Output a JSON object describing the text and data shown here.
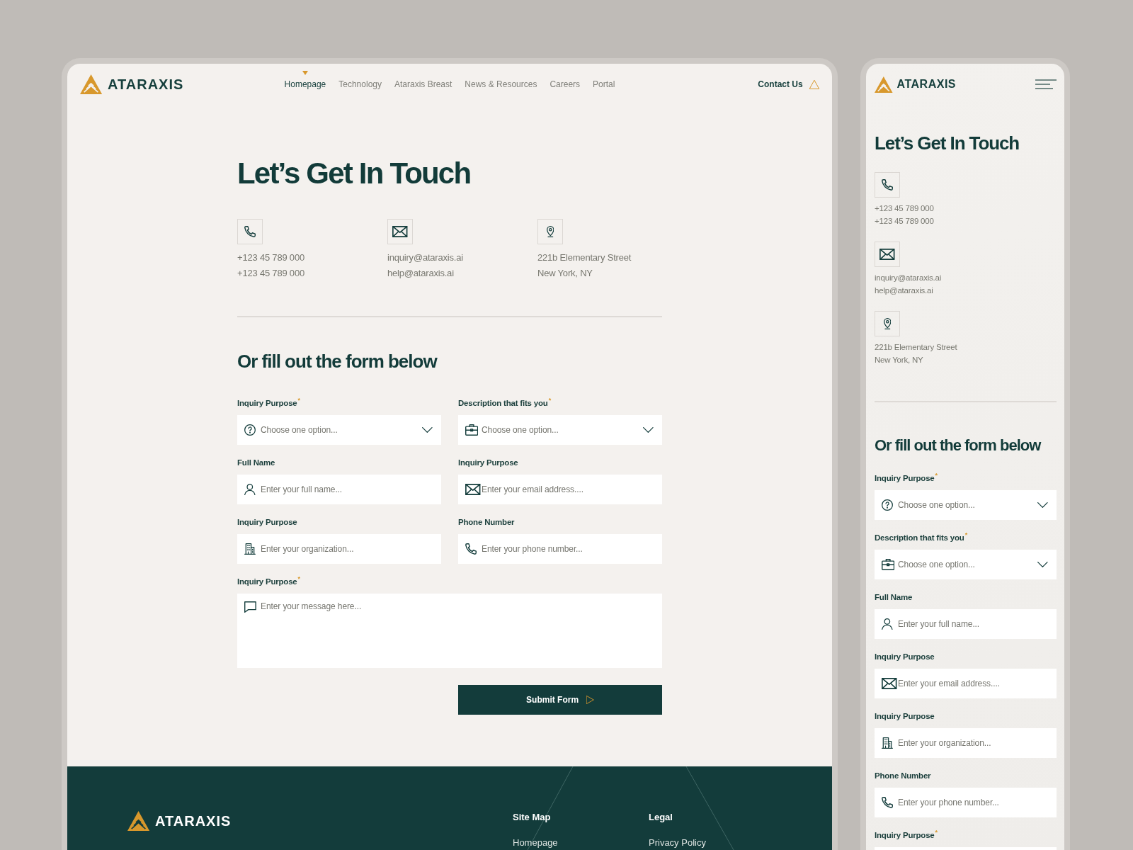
{
  "desktop": {
    "header": {
      "logo": "ATARAXIS",
      "nav": [
        {
          "label": "Homepage",
          "selected": true
        },
        {
          "label": "Technology",
          "selected": false
        },
        {
          "label": "Ataraxis Breast",
          "selected": false
        },
        {
          "label": "News & Resources",
          "selected": false
        },
        {
          "label": "Careers",
          "selected": false
        },
        {
          "label": "Portal",
          "selected": false
        }
      ],
      "contact_link": "Contact Us"
    },
    "contact": {
      "title": "Let’s Get In Touch",
      "items": [
        {
          "kind": "phone",
          "lines": [
            "+123 45 789 000",
            "+123 45 789 000"
          ]
        },
        {
          "kind": "email",
          "lines": [
            "inquiry@ataraxis.ai",
            "help@ataraxis.ai"
          ]
        },
        {
          "kind": "address",
          "lines": [
            "221b Elementary Street",
            "New York, NY"
          ]
        }
      ]
    },
    "form": {
      "title": "Or fill out the form below",
      "fields": [
        {
          "kind": "purpose",
          "label": "Inquiry Purpose$^{*}$",
          "placeholder": "Choose one option..."
        },
        {
          "kind": "role",
          "label": "Description that fits you$^{*}$",
          "placeholder": "Choose one option..."
        },
        {
          "kind": "name",
          "label": "Full Name",
          "placeholder": "Enter your full name..."
        },
        {
          "kind": "email",
          "label": "Inquiry Purpose",
          "placeholder": "Enter your email address...."
        },
        {
          "kind": "organization",
          "label": "Inquiry Purpose",
          "placeholder": "Enter your organization..."
        },
        {
          "kind": "phone",
          "label": "Phone Number",
          "placeholder": "Enter your phone number..."
        },
        {
          "kind": "message",
          "label": "Inquiry Purpose$^{*}$",
          "placeholder": "Enter your message here..."
        }
      ],
      "submit": "Submit Form"
    },
    "footer": {
      "logo": "ATARAXIS",
      "columns": [
        {
          "heading": "Site Map",
          "links": [
            "Homepage"
          ]
        },
        {
          "heading": "Legal",
          "links": [
            "Privacy Policy"
          ]
        }
      ]
    }
  },
  "mobile": {
    "header": {
      "logo": "ATARAXIS"
    },
    "contact": {
      "title": "Let’s Get In Touch",
      "items": [
        {
          "kind": "phone",
          "lines": [
            "+123 45 789 000",
            "+123 45 789 000"
          ]
        },
        {
          "kind": "email",
          "lines": [
            "inquiry@ataraxis.ai",
            "help@ataraxis.ai"
          ]
        },
        {
          "kind": "address",
          "lines": [
            "221b Elementary Street",
            "New York, NY"
          ]
        }
      ]
    },
    "form": {
      "title": "Or fill out the form below",
      "fields": [
        {
          "kind": "purpose",
          "label": "Inquiry Purpose$^{*}$",
          "placeholder": "Choose one option..."
        },
        {
          "kind": "role",
          "label": "Description that fits you$^{*}$",
          "placeholder": "Choose one option..."
        },
        {
          "kind": "name",
          "label": "Full Name",
          "placeholder": "Enter your full name..."
        },
        {
          "kind": "email",
          "label": "Inquiry Purpose",
          "placeholder": "Enter your email address...."
        },
        {
          "kind": "organization",
          "label": "Inquiry Purpose",
          "placeholder": "Enter your organization..."
        },
        {
          "kind": "phone",
          "label": "Phone Number",
          "placeholder": "Enter your phone number..."
        },
        {
          "kind": "message",
          "label": "Inquiry Purpose$^{*}$"
        }
      ]
    }
  }
}
